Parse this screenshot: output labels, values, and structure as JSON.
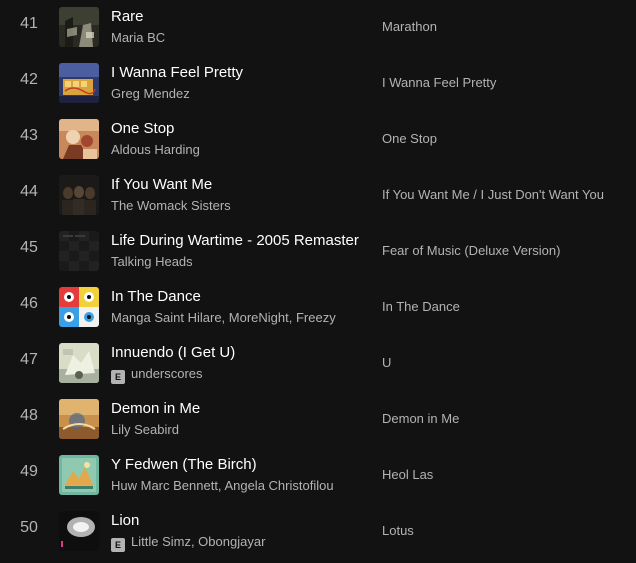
{
  "explicit_label": "E",
  "tracks": [
    {
      "number": "41",
      "title": "Rare",
      "artists": "Maria BC",
      "album": "Marathon",
      "explicit": false,
      "cover_icon": "rare-cover-art"
    },
    {
      "number": "42",
      "title": "I Wanna Feel Pretty",
      "artists": "Greg Mendez",
      "album": "I Wanna Feel Pretty",
      "explicit": false,
      "cover_icon": "i-wanna-feel-pretty-cover-art"
    },
    {
      "number": "43",
      "title": "One Stop",
      "artists": "Aldous Harding",
      "album": "One Stop",
      "explicit": false,
      "cover_icon": "one-stop-cover-art"
    },
    {
      "number": "44",
      "title": "If You Want Me",
      "artists": "The Womack Sisters",
      "album": "If You Want Me / I Just Don't Want You",
      "explicit": false,
      "cover_icon": "if-you-want-me-cover-art"
    },
    {
      "number": "45",
      "title": "Life During Wartime - 2005 Remaster",
      "artists": "Talking Heads",
      "album": "Fear of Music (Deluxe Version)",
      "explicit": false,
      "cover_icon": "fear-of-music-cover-art"
    },
    {
      "number": "46",
      "title": "In The Dance",
      "artists": "Manga Saint Hilare, MoreNight, Freezy",
      "album": "In The Dance",
      "explicit": false,
      "cover_icon": "in-the-dance-cover-art"
    },
    {
      "number": "47",
      "title": "Innuendo (I Get U)",
      "artists": "underscores",
      "album": "U",
      "explicit": true,
      "cover_icon": "u-cover-art"
    },
    {
      "number": "48",
      "title": "Demon in Me",
      "artists": "Lily Seabird",
      "album": "Demon in Me",
      "explicit": false,
      "cover_icon": "demon-in-me-cover-art"
    },
    {
      "number": "49",
      "title": "Y Fedwen (The Birch)",
      "artists": "Huw Marc Bennett, Angela Christofilou",
      "album": "Heol Las",
      "explicit": false,
      "cover_icon": "heol-las-cover-art"
    },
    {
      "number": "50",
      "title": "Lion",
      "artists": "Little Simz, Obongjayar",
      "album": "Lotus",
      "explicit": true,
      "cover_icon": "lotus-cover-art"
    }
  ]
}
